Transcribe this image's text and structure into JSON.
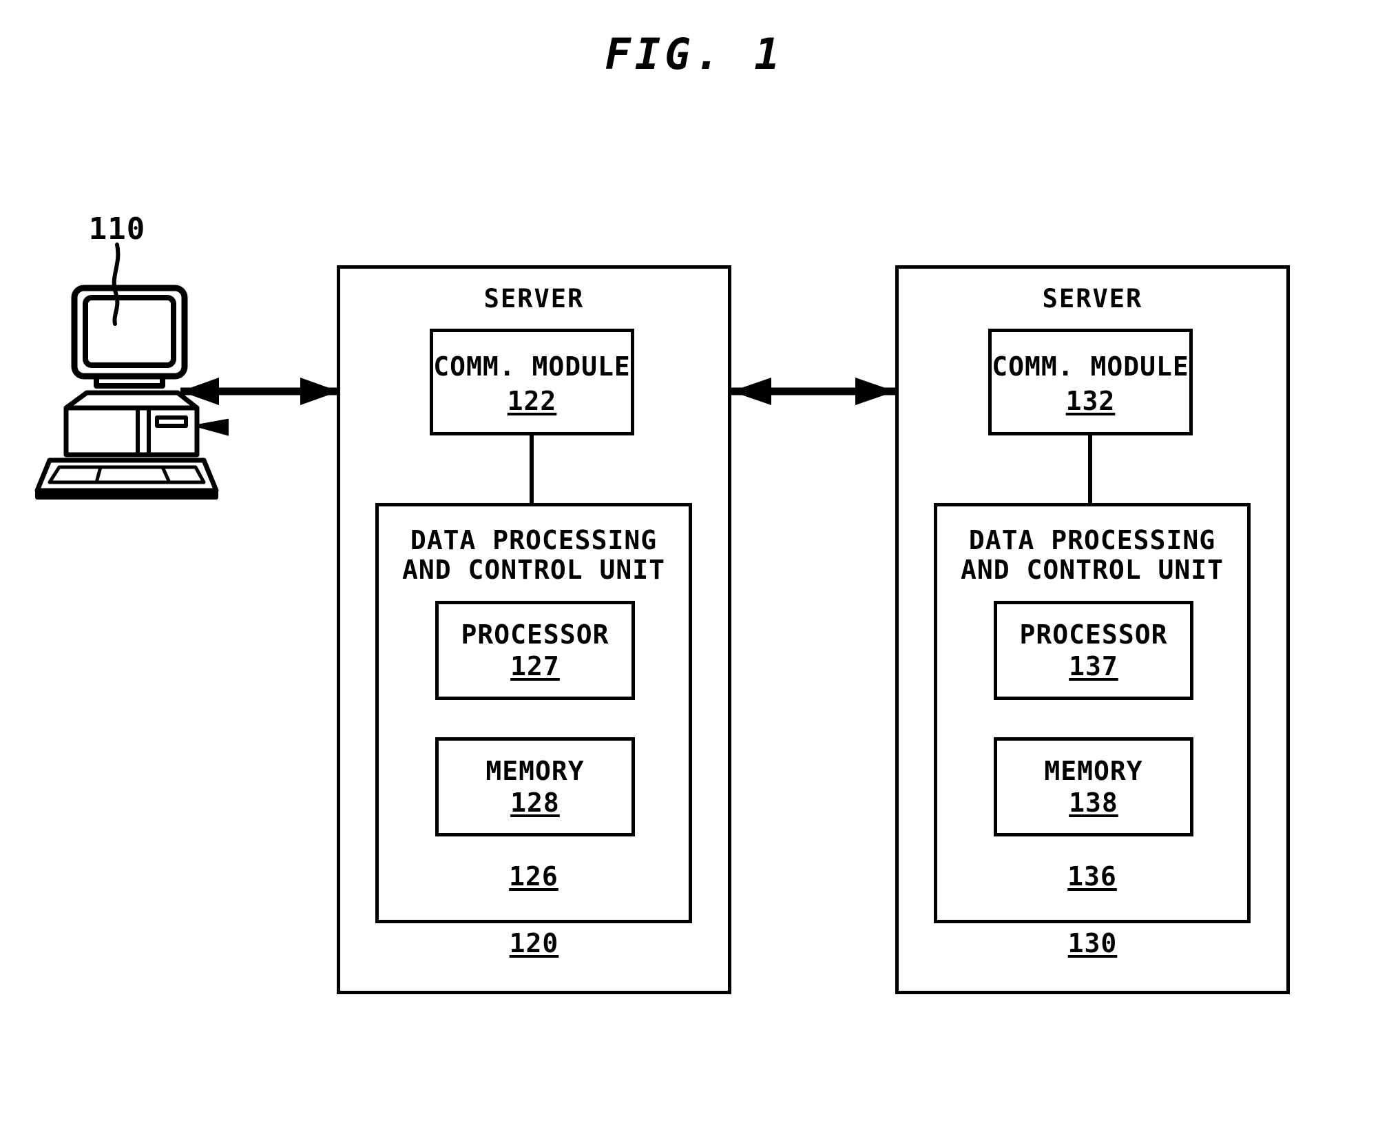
{
  "figure": {
    "title": "FIG. 1",
    "type": "patent-block-diagram",
    "line_color": "#000000",
    "background_color": "#ffffff"
  },
  "client": {
    "ref_number": "110",
    "icon": "desktop-computer-icon"
  },
  "links": {
    "client_to_server1": "double-headed-arrow",
    "server1_to_server2": "double-headed-arrow"
  },
  "servers": [
    {
      "title": "SERVER",
      "ref_number": "120",
      "comm_module": {
        "label": "COMM. MODULE",
        "ref_number": "122"
      },
      "dpcu": {
        "label_line1": "DATA PROCESSING",
        "label_line2": "AND CONTROL UNIT",
        "ref_number": "126",
        "processor": {
          "label": "PROCESSOR",
          "ref_number": "127"
        },
        "memory": {
          "label": "MEMORY",
          "ref_number": "128"
        }
      }
    },
    {
      "title": "SERVER",
      "ref_number": "130",
      "comm_module": {
        "label": "COMM. MODULE",
        "ref_number": "132"
      },
      "dpcu": {
        "label_line1": "DATA PROCESSING",
        "label_line2": "AND CONTROL UNIT",
        "ref_number": "136",
        "processor": {
          "label": "PROCESSOR",
          "ref_number": "137"
        },
        "memory": {
          "label": "MEMORY",
          "ref_number": "138"
        }
      }
    }
  ]
}
